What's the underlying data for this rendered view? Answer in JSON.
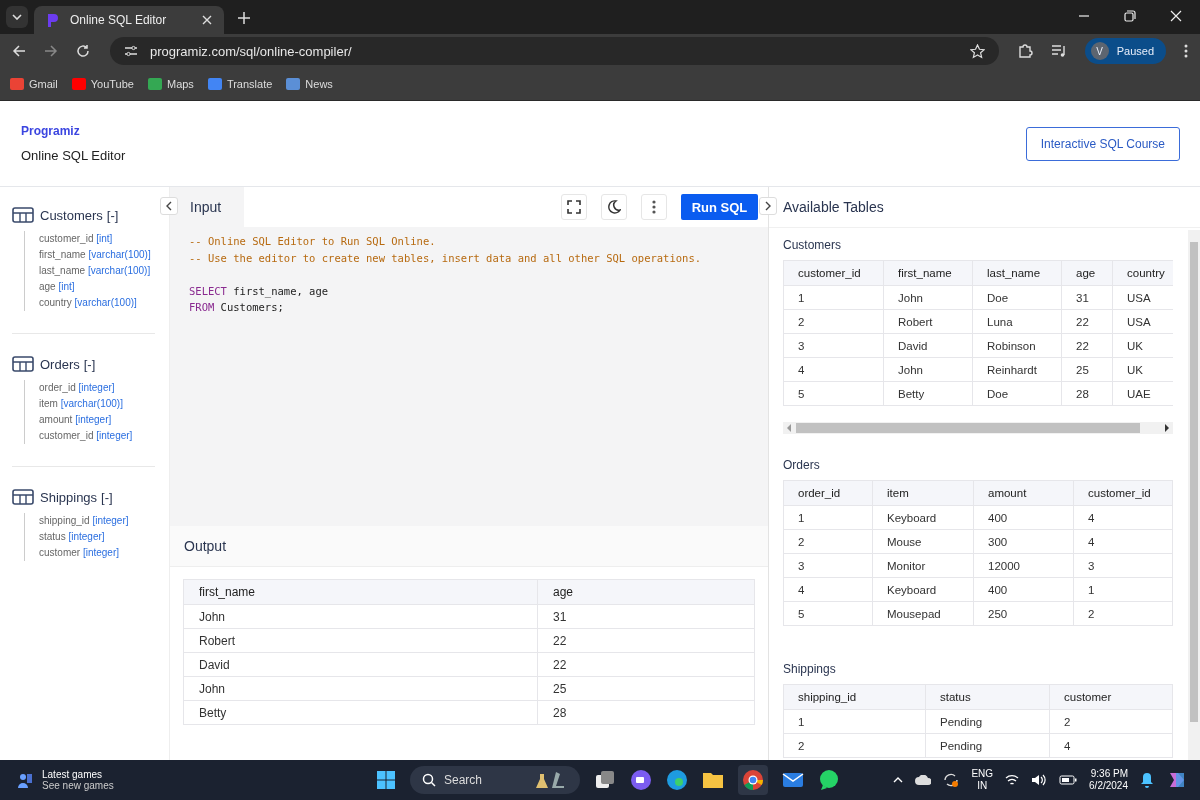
{
  "browser": {
    "tabs": [
      {
        "title": "Online SQL Editor",
        "selected": true
      }
    ],
    "address": "programiz.com/sql/online-compiler/",
    "bookmarks": [
      "Gmail",
      "YouTube",
      "Maps",
      "Translate",
      "News"
    ],
    "profile": {
      "initial": "V",
      "status": "Paused"
    }
  },
  "header": {
    "logo": "Programiz",
    "subtitle": "Online SQL Editor",
    "course_button": "Interactive SQL Course"
  },
  "schema": [
    {
      "name": "Customers",
      "toggle": "[-]",
      "columns": [
        {
          "name": "customer_id",
          "type": "[int]"
        },
        {
          "name": "first_name",
          "type": "[varchar(100)]"
        },
        {
          "name": "last_name",
          "type": "[varchar(100)]"
        },
        {
          "name": "age",
          "type": "[int]"
        },
        {
          "name": "country",
          "type": "[varchar(100)]"
        }
      ]
    },
    {
      "name": "Orders",
      "toggle": "[-]",
      "columns": [
        {
          "name": "order_id",
          "type": "[integer]"
        },
        {
          "name": "item",
          "type": "[varchar(100)]"
        },
        {
          "name": "amount",
          "type": "[integer]"
        },
        {
          "name": "customer_id",
          "type": "[integer]"
        }
      ]
    },
    {
      "name": "Shippings",
      "toggle": "[-]",
      "columns": [
        {
          "name": "shipping_id",
          "type": "[integer]"
        },
        {
          "name": "status",
          "type": "[integer]"
        },
        {
          "name": "customer",
          "type": "[integer]"
        }
      ]
    }
  ],
  "editor": {
    "title": "Input",
    "run_button": "Run SQL",
    "blocks": [
      [
        [
          {
            "kind": "comment",
            "text": "-- Online SQL Editor to Run SQL Online."
          }
        ],
        [
          {
            "kind": "comment",
            "text": "-- Use the editor to create new tables, insert data and all other SQL operations."
          }
        ]
      ],
      [
        [
          {
            "kind": "keyword",
            "text": "SELECT"
          },
          {
            "kind": "plain",
            "text": " first_name, age"
          }
        ],
        [
          {
            "kind": "keyword",
            "text": "FROM"
          },
          {
            "kind": "plain",
            "text": " Customers;"
          }
        ]
      ]
    ]
  },
  "output": {
    "title": "Output",
    "columns": [
      "first_name",
      "age"
    ],
    "rows": [
      [
        "John",
        "31"
      ],
      [
        "Robert",
        "22"
      ],
      [
        "David",
        "22"
      ],
      [
        "John",
        "25"
      ],
      [
        "Betty",
        "28"
      ]
    ]
  },
  "available": {
    "title": "Available Tables",
    "tables": [
      {
        "name": "Customers",
        "scrollable": true,
        "columns": [
          "customer_id",
          "first_name",
          "last_name",
          "age",
          "country"
        ],
        "rows": [
          [
            "1",
            "John",
            "Doe",
            "31",
            "USA"
          ],
          [
            "2",
            "Robert",
            "Luna",
            "22",
            "USA"
          ],
          [
            "3",
            "David",
            "Robinson",
            "22",
            "UK"
          ],
          [
            "4",
            "John",
            "Reinhardt",
            "25",
            "UK"
          ],
          [
            "5",
            "Betty",
            "Doe",
            "28",
            "UAE"
          ]
        ]
      },
      {
        "name": "Orders",
        "scrollable": false,
        "columns": [
          "order_id",
          "item",
          "amount",
          "customer_id"
        ],
        "rows": [
          [
            "1",
            "Keyboard",
            "400",
            "4"
          ],
          [
            "2",
            "Mouse",
            "300",
            "4"
          ],
          [
            "3",
            "Monitor",
            "12000",
            "3"
          ],
          [
            "4",
            "Keyboard",
            "400",
            "1"
          ],
          [
            "5",
            "Mousepad",
            "250",
            "2"
          ]
        ]
      },
      {
        "name": "Shippings",
        "scrollable": false,
        "columns": [
          "shipping_id",
          "status",
          "customer"
        ],
        "rows": [
          [
            "1",
            "Pending",
            "2"
          ],
          [
            "2",
            "Pending",
            "4"
          ]
        ]
      }
    ]
  },
  "taskbar": {
    "widget_title": "Latest games",
    "widget_subtitle": "See new games",
    "search_placeholder": "Search",
    "language": "ENG",
    "region": "IN",
    "time": "9:36 PM",
    "date": "6/2/2024"
  }
}
